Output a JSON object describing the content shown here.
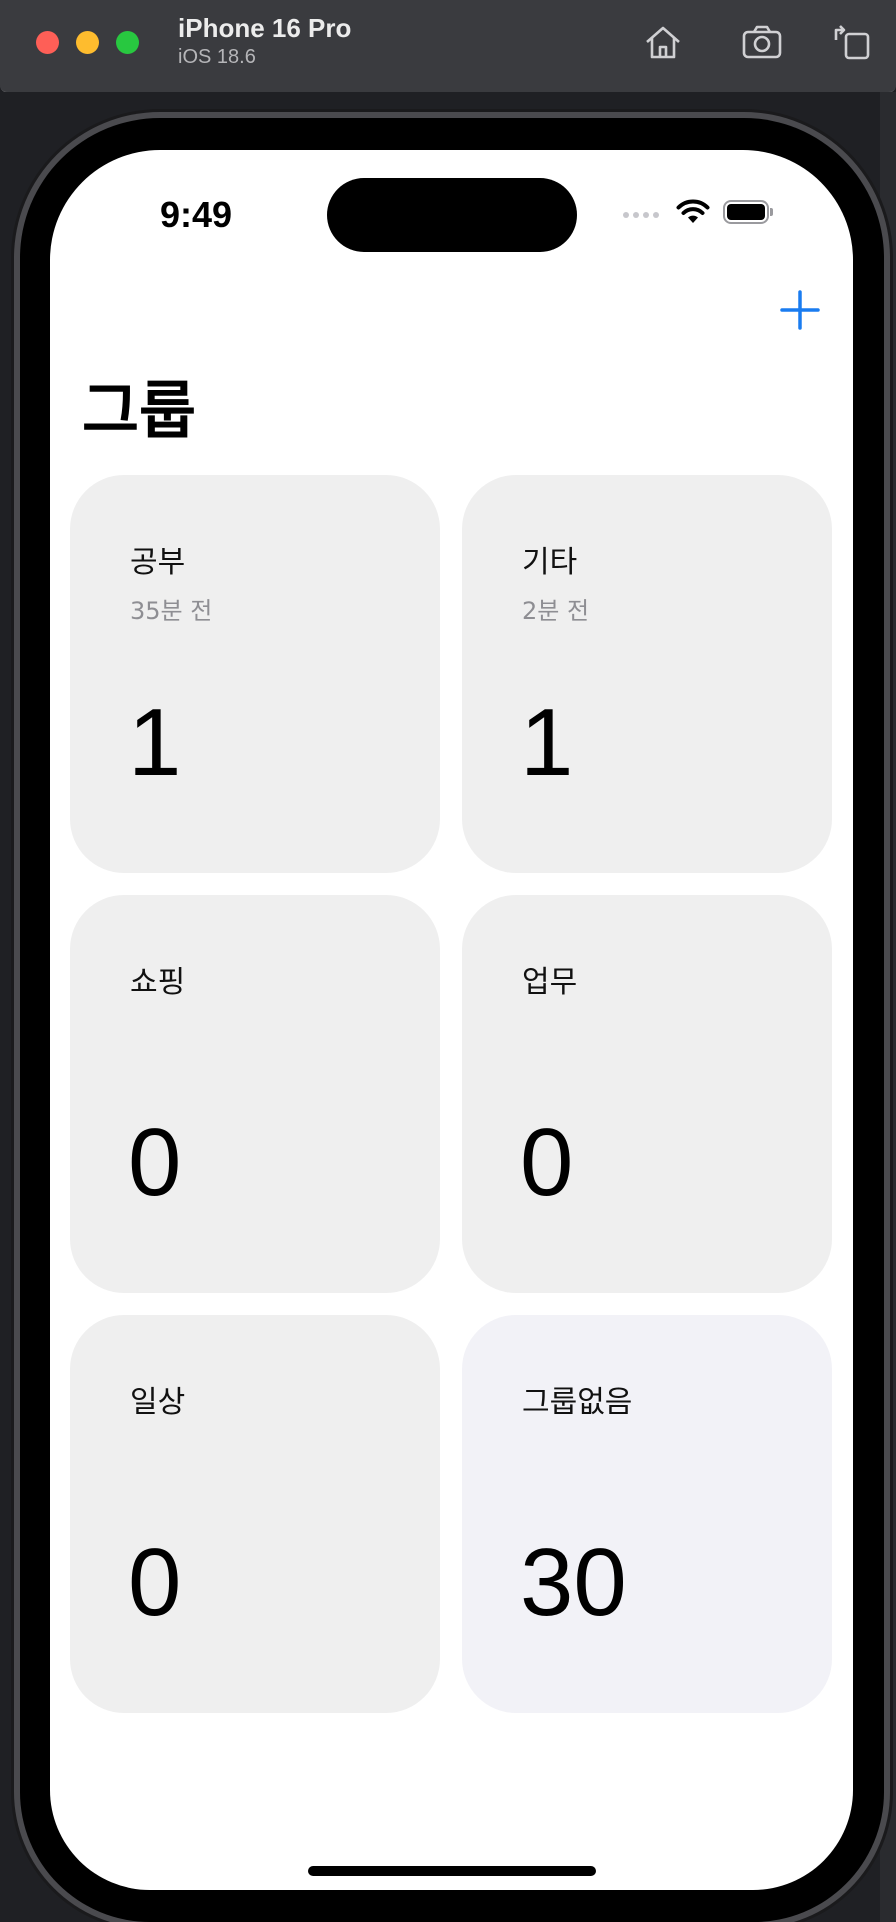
{
  "simulator": {
    "device_name": "iPhone 16 Pro",
    "os_version": "iOS 18.6",
    "icons": [
      "home-icon",
      "screenshot-icon",
      "rotate-icon"
    ]
  },
  "status_bar": {
    "time": "9:49",
    "icons": [
      "cellular-icon",
      "wifi-icon",
      "battery-icon"
    ]
  },
  "nav": {
    "title": "그룹",
    "add_icon": "plus-icon",
    "accent_color": "#1a7cf0"
  },
  "groups": [
    {
      "name": "공부",
      "time": "35분 전",
      "count": "1"
    },
    {
      "name": "기타",
      "time": "2분 전",
      "count": "1"
    },
    {
      "name": "쇼핑",
      "time": "",
      "count": "0"
    },
    {
      "name": "업무",
      "time": "",
      "count": "0"
    },
    {
      "name": "일상",
      "time": "",
      "count": "0"
    },
    {
      "name": "그룹없음",
      "time": "",
      "count": "30"
    }
  ],
  "colors": {
    "card_background": "#efefef",
    "ungrouped_card_background": "#f2f2f7",
    "secondary_text": "#8e8e93"
  }
}
